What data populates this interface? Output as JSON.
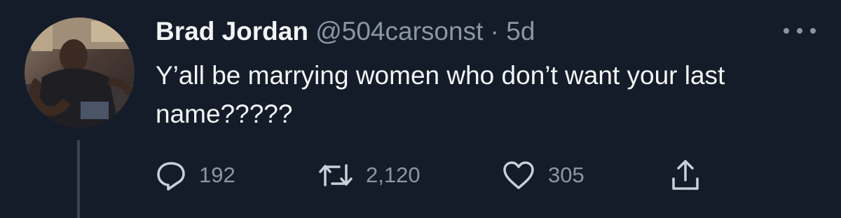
{
  "tweet": {
    "author": {
      "display_name": "Brad Jordan",
      "handle": "@504carsonst",
      "separator": "·",
      "age": "5d"
    },
    "text": "Y’all be marrying women who don’t want your last name?????",
    "actions": {
      "replies": "192",
      "retweets": "2,120",
      "likes": "305"
    },
    "icons": {
      "reply": "reply-icon",
      "retweet": "retweet-icon",
      "like": "heart-icon",
      "share": "share-icon",
      "more": "more-options-icon"
    }
  },
  "colors": {
    "background": "#151c29",
    "primary_text": "#f2f4f7",
    "secondary_text": "#8b96a5"
  }
}
